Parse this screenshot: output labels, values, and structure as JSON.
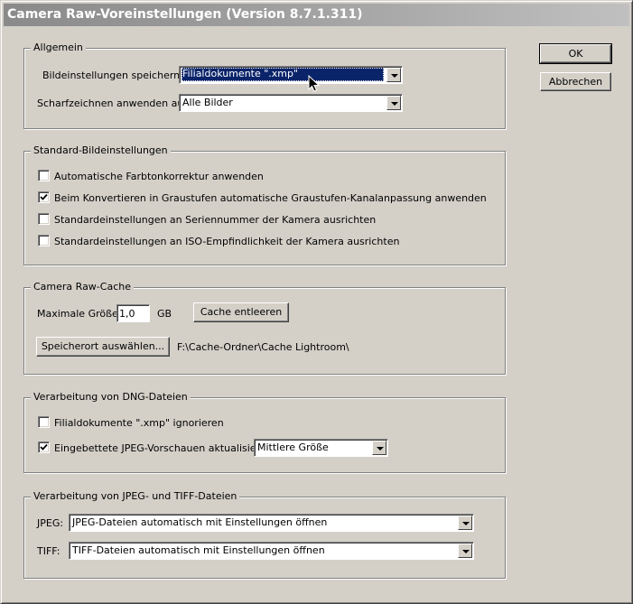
{
  "window": {
    "title": "Camera Raw-Voreinstellungen  (Version 8.7.1.311)"
  },
  "buttons": {
    "ok": "OK",
    "cancel": "Abbrechen"
  },
  "general": {
    "title": "Allgemein",
    "save_label": "Bildeinstellungen speichern in:",
    "save_value": "Filialdokumente \".xmp\"",
    "sharpen_label": "Scharfzeichnen anwenden auf:",
    "sharpen_value": "Alle Bilder"
  },
  "defaults": {
    "title": "Standard-Bildeinstellungen",
    "items": [
      {
        "label": "Automatische Farbtonkorrektur anwenden",
        "checked": false
      },
      {
        "label": "Beim Konvertieren in Graustufen automatische Graustufen-Kanalanpassung anwenden",
        "checked": true
      },
      {
        "label": "Standardeinstellungen an Seriennummer der Kamera ausrichten",
        "checked": false
      },
      {
        "label": "Standardeinstellungen an ISO-Empfindlichkeit der Kamera ausrichten",
        "checked": false
      }
    ]
  },
  "cache": {
    "title": "Camera Raw-Cache",
    "max_size_label": "Maximale Größe:",
    "max_size_value": "1,0",
    "unit": "GB",
    "purge_button": "Cache entleeren",
    "location_button": "Speicherort auswählen...",
    "location_path": "F:\\Cache-Ordner\\Cache Lightroom\\"
  },
  "dng": {
    "title": "Verarbeitung von DNG-Dateien",
    "ignore_label": "Filialdokumente \".xmp\" ignorieren",
    "ignore_checked": false,
    "update_label": "Eingebettete JPEG-Vorschauen aktualisieren:",
    "update_checked": true,
    "update_value": "Mittlere Größe"
  },
  "jpeg_tiff": {
    "title": "Verarbeitung von JPEG- und TIFF-Dateien",
    "jpeg_label": "JPEG:",
    "jpeg_value": "JPEG-Dateien automatisch mit Einstellungen öffnen",
    "tiff_label": "TIFF:",
    "tiff_value": "TIFF-Dateien automatisch mit Einstellungen öffnen"
  },
  "icons": {
    "check": "checkmark-icon",
    "dropdown": "chevron-down-icon",
    "pointer": "mouse-pointer-icon"
  },
  "colors": {
    "selection": "#0a246a",
    "face": "#d4d0c8",
    "title_text": "#ffffff"
  }
}
